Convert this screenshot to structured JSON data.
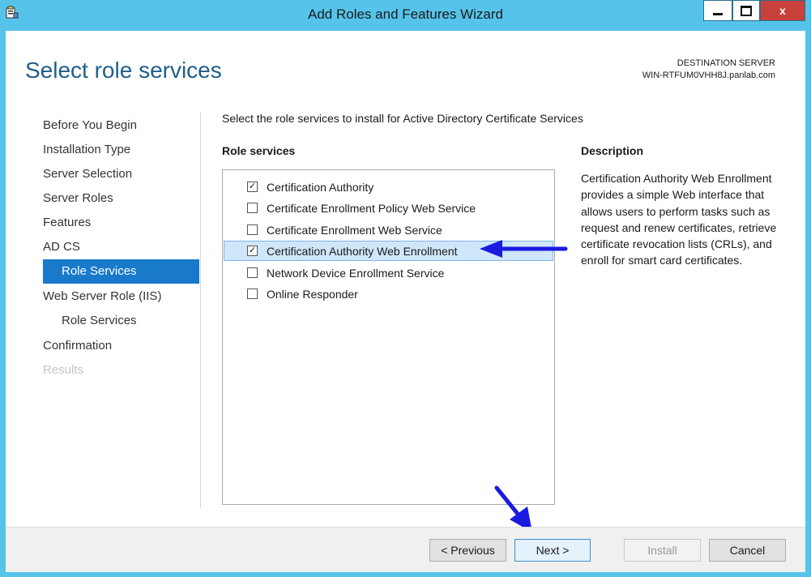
{
  "window": {
    "title": "Add Roles and Features Wizard",
    "close_label": "x",
    "accent": "#56c4ea"
  },
  "header": {
    "page_title": "Select role services",
    "destination_label": "DESTINATION SERVER",
    "destination_server": "WIN-RTFUM0VHH8J.panlab.com"
  },
  "nav": {
    "items": [
      {
        "label": "Before You Begin",
        "state": "normal"
      },
      {
        "label": "Installation Type",
        "state": "normal"
      },
      {
        "label": "Server Selection",
        "state": "normal"
      },
      {
        "label": "Server Roles",
        "state": "normal"
      },
      {
        "label": "Features",
        "state": "normal"
      },
      {
        "label": "AD CS",
        "state": "normal"
      },
      {
        "label": "Role Services",
        "state": "active"
      },
      {
        "label": "Web Server Role (IIS)",
        "state": "normal"
      },
      {
        "label": "Role Services",
        "state": "normal"
      },
      {
        "label": "Confirmation",
        "state": "normal"
      },
      {
        "label": "Results",
        "state": "disabled"
      }
    ]
  },
  "main": {
    "intro": "Select the role services to install for Active Directory Certificate Services",
    "role_services_heading": "Role services",
    "description_heading": "Description",
    "role_services": [
      {
        "label": "Certification Authority",
        "checked": true
      },
      {
        "label": "Certificate Enrollment Policy Web Service",
        "checked": false
      },
      {
        "label": "Certificate Enrollment Web Service",
        "checked": false
      },
      {
        "label": "Certification Authority Web Enrollment",
        "checked": true,
        "selected": true
      },
      {
        "label": "Network Device Enrollment Service",
        "checked": false
      },
      {
        "label": "Online Responder",
        "checked": false
      }
    ],
    "description": "Certification Authority Web Enrollment provides a simple Web interface that allows users to perform tasks such as request and renew certificates, retrieve certificate revocation lists (CRLs), and enroll for smart card certificates."
  },
  "footer": {
    "previous_label": "< Previous",
    "next_label": "Next >",
    "install_label": "Install",
    "cancel_label": "Cancel"
  },
  "annotations": {
    "arrow_color": "#1a1ae0"
  }
}
